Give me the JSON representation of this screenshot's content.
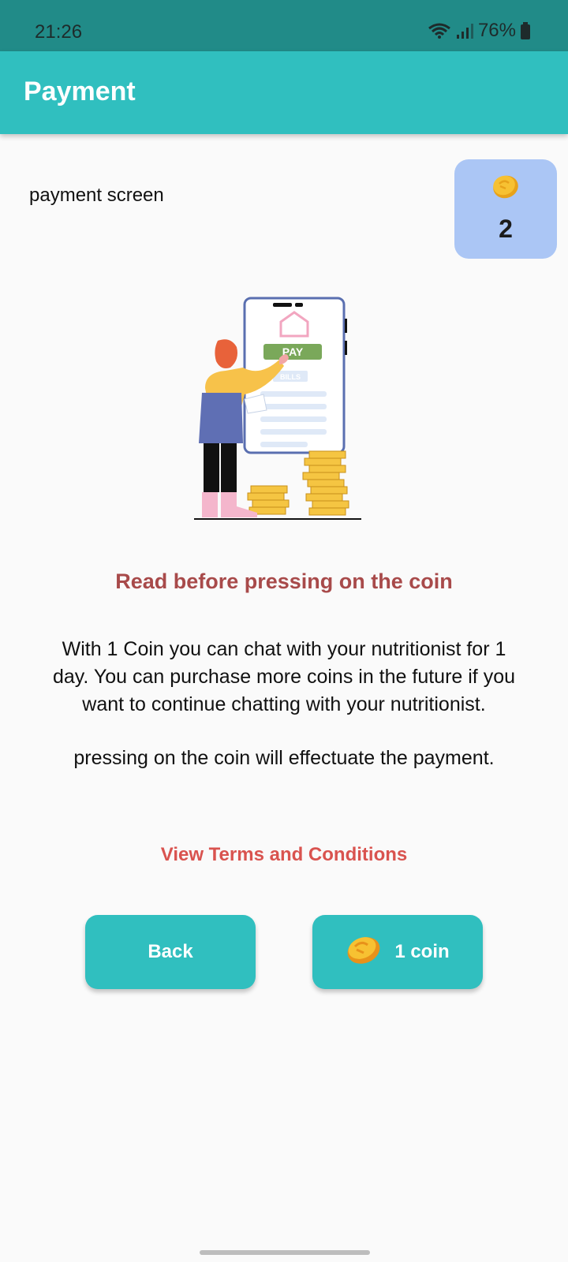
{
  "status_bar": {
    "time": "21:26",
    "battery": "76%"
  },
  "app_bar": {
    "title": "Payment"
  },
  "page": {
    "subtitle": "payment screen",
    "coin_balance": "2",
    "illustration": {
      "pay_label": "PAY",
      "bills_label": "BILLS"
    },
    "warning_title": "Read before pressing on the coin",
    "info_paragraph_1": "With 1 Coin you can chat with your nutritionist for 1 day. You can purchase more coins in the future if you want to continue chatting with your nutritionist.",
    "info_paragraph_2": "pressing on the coin will effectuate the payment.",
    "terms_link": "View Terms and Conditions"
  },
  "buttons": {
    "back_label": "Back",
    "coin_label": "1 coin"
  },
  "colors": {
    "primary": "#30bfbf",
    "status_bar": "#218b88",
    "coin_card": "#abc6f5",
    "warning": "#a84a4a",
    "link": "#d9534f"
  },
  "icons": {
    "wifi": "wifi-icon",
    "signal": "signal-icon",
    "battery": "battery-icon",
    "coin": "coin-icon"
  }
}
